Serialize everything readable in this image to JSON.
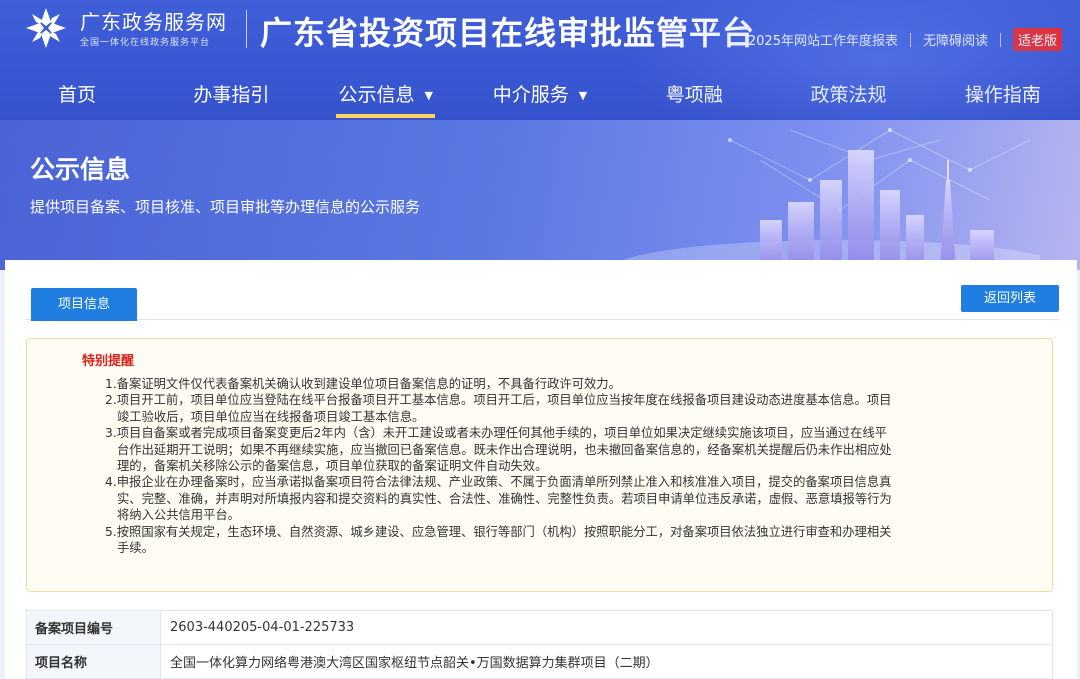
{
  "header": {
    "brand_name": "广东政务服务网",
    "brand_sub": "全国一体化在线政务服务平台",
    "platform_title": "广东省投资项目在线审批监管平台",
    "links": [
      "2025年网站工作年度报表",
      "无障碍阅读"
    ],
    "elder_mode": "适老版"
  },
  "nav": [
    {
      "label": "首页",
      "dropdown": false,
      "active": false
    },
    {
      "label": "办事指引",
      "dropdown": false,
      "active": false
    },
    {
      "label": "公示信息",
      "dropdown": true,
      "active": true
    },
    {
      "label": "中介服务",
      "dropdown": true,
      "active": false
    },
    {
      "label": "粤项融",
      "dropdown": false,
      "active": false
    },
    {
      "label": "政策法规",
      "dropdown": false,
      "active": false
    },
    {
      "label": "操作指南",
      "dropdown": false,
      "active": false
    }
  ],
  "banner": {
    "title": "公示信息",
    "desc": "提供项目备案、项目核准、项目审批等办理信息的公示服务"
  },
  "tabs": {
    "active_label": "项目信息",
    "back_label": "返回列表"
  },
  "notice": {
    "title": "特别提醒",
    "items": [
      "1.备案证明文件仅代表备案机关确认收到建设单位项目备案信息的证明，不具备行政许可效力。",
      "2.项目开工前，项目单位应当登陆在线平台报备项目开工基本信息。项目开工后，项目单位应当按年度在线报备项目建设动态进度基本信息。项目竣工验收后，项目单位应当在线报备项目竣工基本信息。",
      "3.项目自备案或者完成项目备案变更后2年内（含）未开工建设或者未办理任何其他手续的，项目单位如果决定继续实施该项目，应当通过在线平台作出延期开工说明；如果不再继续实施，应当撤回已备案信息。既未作出合理说明，也未撤回备案信息的，经备案机关提醒后仍未作出相应处理的，备案机关移除公示的备案信息，项目单位获取的备案证明文件自动失效。",
      "4.申报企业在办理备案时，应当承诺拟备案项目符合法律法规、产业政策、不属于负面清单所列禁止准入和核准准入项目，提交的备案项目信息真实、完整、准确，并声明对所填报内容和提交资料的真实性、合法性、准确性、完整性负责。若项目申请单位违反承诺，虚假、恶意填报等行为将纳入公共信用平台。",
      "5.按照国家有关规定，生态环境、自然资源、城乡建设、应急管理、银行等部门（机构）按照职能分工，对备案项目依法独立进行审查和办理相关手续。"
    ]
  },
  "project": {
    "rows": [
      {
        "key": "备案项目编号",
        "value": "2603-440205-04-01-225733"
      },
      {
        "key": "项目名称",
        "value": "全国一体化算力网络粤港澳大湾区国家枢纽节点韶关•万国数据算力集群项目（二期）"
      }
    ]
  },
  "colors": {
    "header_blue": "#3a57d3",
    "accent_blue": "#1f7ee0",
    "nav_active": "#ffd45e",
    "alert_red": "#d9251d"
  }
}
